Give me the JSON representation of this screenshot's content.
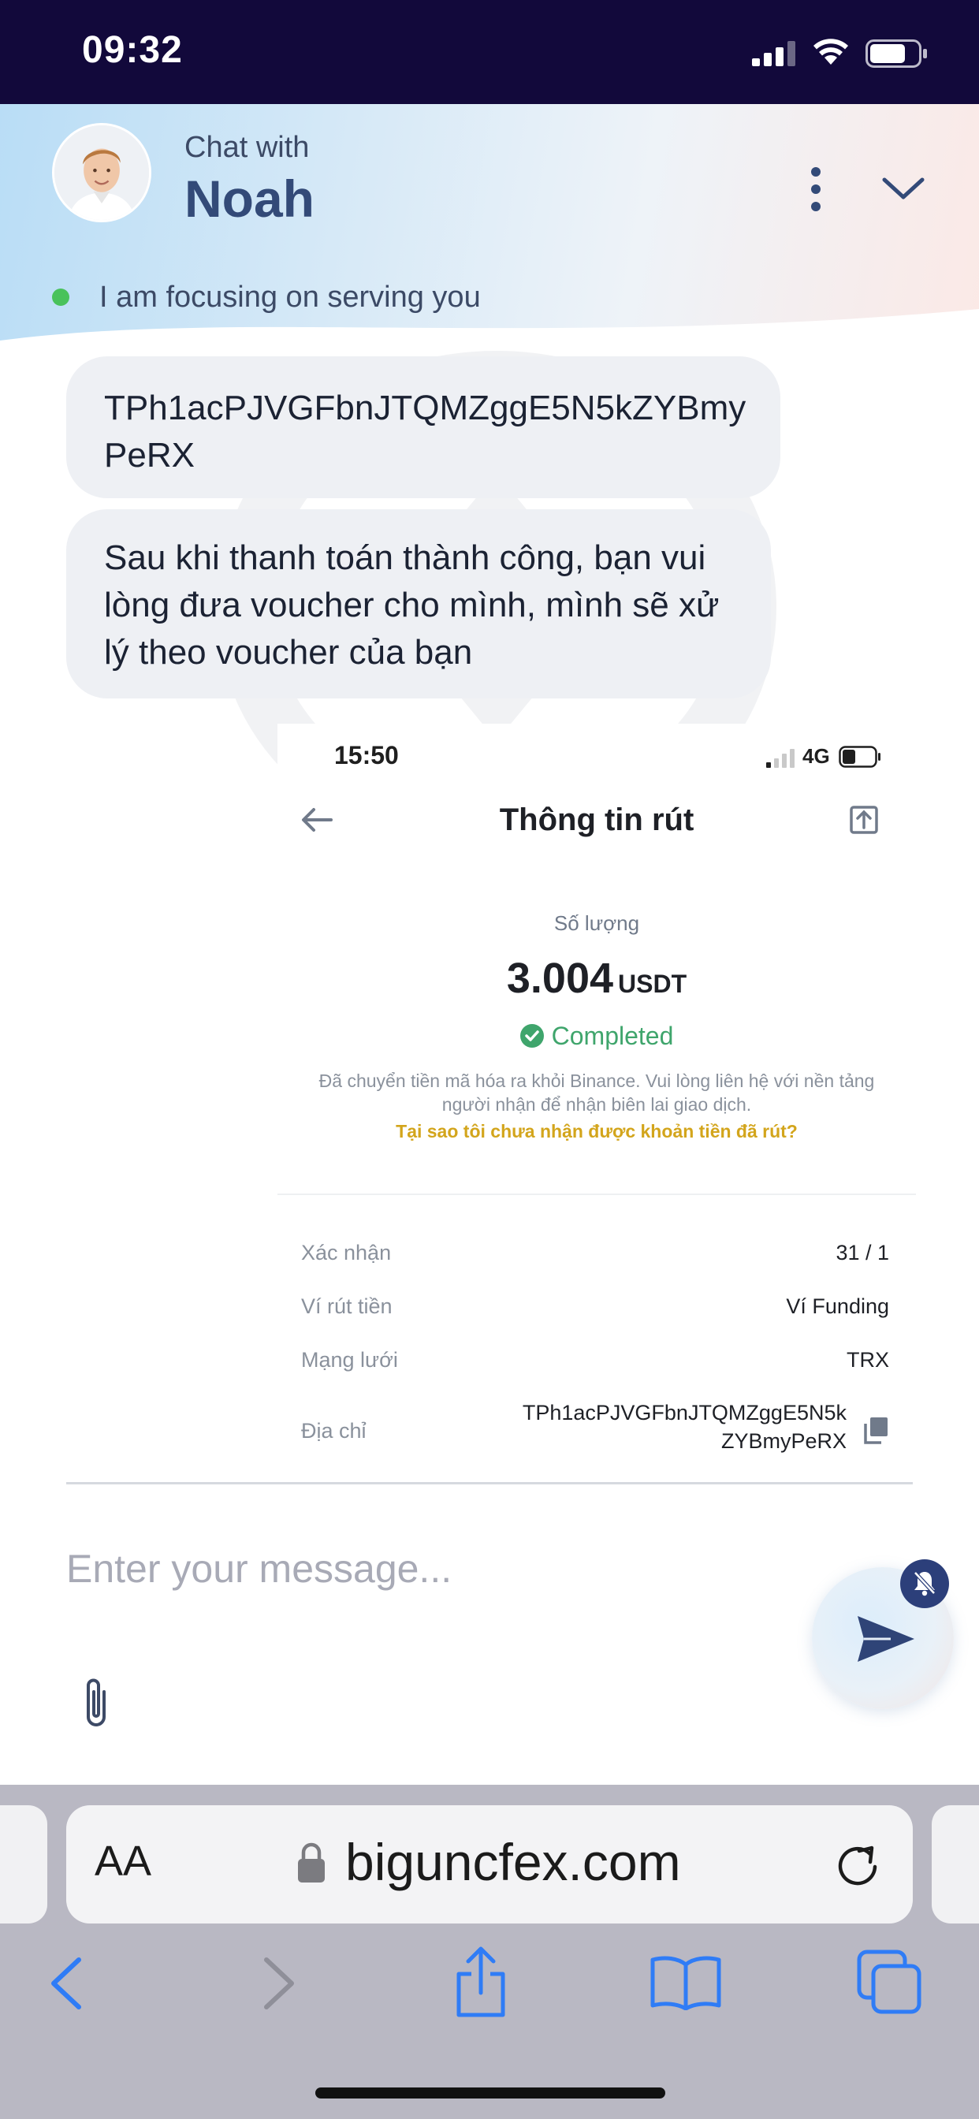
{
  "status_bar": {
    "time": "09:32",
    "icons": [
      "cellular-signal-icon",
      "wifi-icon",
      "battery-icon"
    ]
  },
  "chat_header": {
    "subtitle": "Chat with",
    "agent_name": "Noah",
    "status_text": "I am focusing on serving you",
    "status_color": "#49c25b",
    "icons": [
      "avatar",
      "more-vertical-icon",
      "chevron-down-icon"
    ]
  },
  "messages": [
    {
      "type": "text",
      "text": "TPh1acPJVGFbnJTQMZggE5N5kZYBmy PeRX"
    },
    {
      "type": "text",
      "text": "Sau khi thanh toán thành công, bạn vui lòng đưa voucher cho mình, mình sẽ xử lý theo voucher của bạn"
    }
  ],
  "screenshot": {
    "time": "15:50",
    "network": "4G",
    "title": "Thông tin rút",
    "quantity_label": "Số lượng",
    "amount": "3.004",
    "unit": "USDT",
    "status": "Completed",
    "status_color": "#3fa56c",
    "note": "Đã chuyển tiền mã hóa ra khỏi Binance. Vui lòng liên hệ với nền tảng người nhận để nhận biên lai giao dịch.",
    "help_link": "Tại sao tôi chưa nhận được khoản tiền đã rút?",
    "details": [
      {
        "label": "Xác nhận",
        "value": "31 / 1"
      },
      {
        "label": "Ví rút tiền",
        "value": "Ví Funding"
      },
      {
        "label": "Mạng lưới",
        "value": "TRX"
      },
      {
        "label": "Địa chỉ",
        "value_line1": "TPh1acPJVGFbnJTQMZggE5N5k",
        "value_line2": "ZYBmyPeRX"
      }
    ]
  },
  "composer": {
    "placeholder": "Enter your message...",
    "icons": [
      "paperclip-icon",
      "send-icon",
      "notification-muted-icon"
    ]
  },
  "browser": {
    "text_size_label": "AA",
    "url": "biguncfex.com",
    "icons": [
      "lock-icon",
      "reload-icon",
      "back-icon",
      "forward-icon",
      "share-icon",
      "bookmarks-icon",
      "tabs-icon"
    ],
    "accent_color": "#2f7cf6"
  }
}
